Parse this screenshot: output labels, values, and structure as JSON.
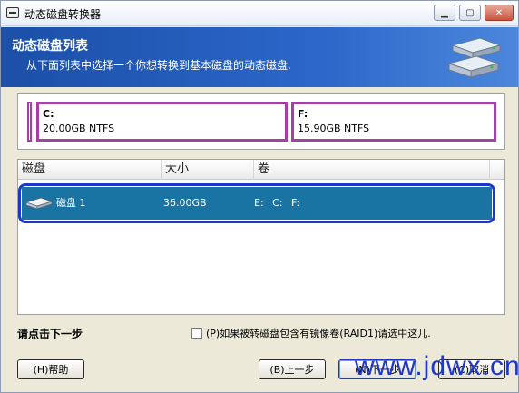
{
  "window": {
    "title": "动态磁盘转换器",
    "controls": {
      "minimize": "▁",
      "maximize": "▢",
      "close": "✕"
    }
  },
  "header": {
    "title": "动态磁盘列表",
    "subtitle": "从下面列表中选择一个你想转换到基本磁盘的动态磁盘.",
    "icon": "disks-icon"
  },
  "volumes": [
    {
      "letter": "C:",
      "info": "20.00GB NTFS"
    },
    {
      "letter": "F:",
      "info": "15.90GB NTFS"
    }
  ],
  "accent_colors": {
    "volume_border": "#a63ea6",
    "selection": "#1a74a3",
    "outline": "#1f37c8"
  },
  "list": {
    "columns": [
      "磁盘",
      "大小",
      "卷"
    ],
    "rows": [
      {
        "icon": "disk-icon",
        "name": "磁盘 1",
        "size": "36.00GB",
        "volumes": "E: C: F:"
      }
    ]
  },
  "footer": {
    "hint": "请点击下一步",
    "raid_checkbox": "(P)如果被转磁盘包含有镜像卷(RAID1)请选中这儿.",
    "buttons": {
      "help": "(H)帮助",
      "back": "(B)上一步",
      "next": "(N)下一步",
      "cancel": "(C)取消"
    }
  },
  "watermark": "www.jdwx.cn"
}
